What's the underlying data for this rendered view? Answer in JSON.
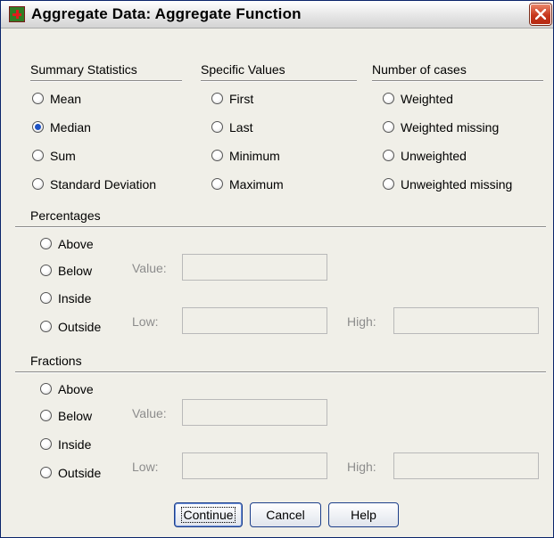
{
  "window": {
    "title": "Aggregate Data: Aggregate Function",
    "icon": "spss-grid-plus-icon",
    "close_icon": "close-x-icon"
  },
  "summary_statistics": {
    "title": "Summary Statistics",
    "options": [
      "Mean",
      "Median",
      "Sum",
      "Standard Deviation"
    ],
    "selected": "Median"
  },
  "specific_values": {
    "title": "Specific Values",
    "options": [
      "First",
      "Last",
      "Minimum",
      "Maximum"
    ]
  },
  "number_of_cases": {
    "title": "Number of cases",
    "options": [
      "Weighted",
      "Weighted missing",
      "Unweighted",
      "Unweighted missing"
    ]
  },
  "percentages": {
    "title": "Percentages",
    "options": [
      "Above",
      "Below",
      "Inside",
      "Outside"
    ],
    "value_label": "Value:",
    "low_label": "Low:",
    "high_label": "High:",
    "value": "",
    "low": "",
    "high": ""
  },
  "fractions": {
    "title": "Fractions",
    "options": [
      "Above",
      "Below",
      "Inside",
      "Outside"
    ],
    "value_label": "Value:",
    "low_label": "Low:",
    "high_label": "High:",
    "value": "",
    "low": "",
    "high": ""
  },
  "buttons": {
    "continue": "Continue",
    "cancel": "Cancel",
    "help": "Help"
  },
  "colors": {
    "title_border": "#0a246a",
    "radio_selected": "#1d52c4",
    "close_button": "#c7371d",
    "dialog_bg": "#f0efe8"
  }
}
